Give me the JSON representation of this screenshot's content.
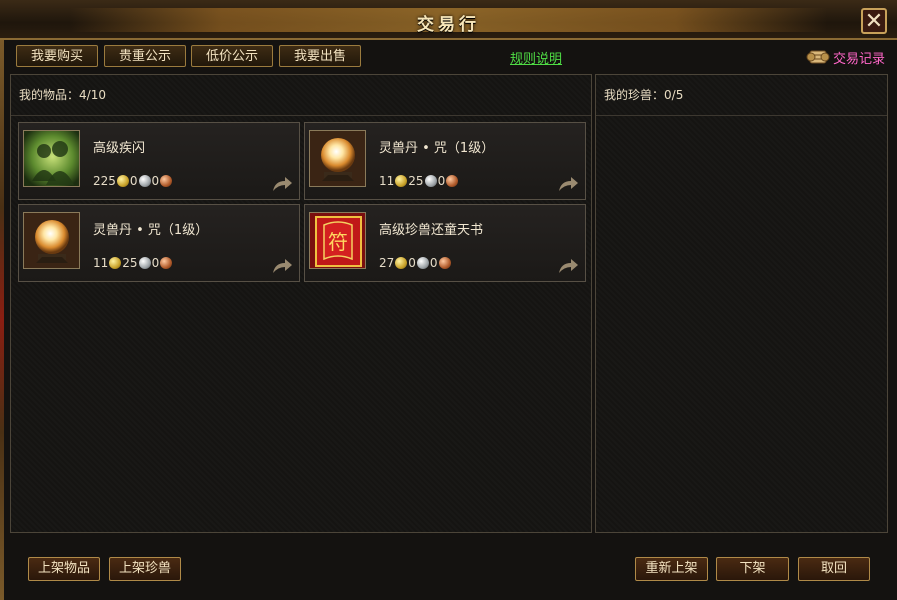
{
  "window": {
    "title": "交易行",
    "close_glyph": "✕"
  },
  "tabs": [
    {
      "label": "我要购买"
    },
    {
      "label": "贵重公示"
    },
    {
      "label": "低价公示"
    },
    {
      "label": "我要出售"
    }
  ],
  "rules_link": "规则说明",
  "trade_record": {
    "label": "交易记录",
    "icon": "scroll-icon"
  },
  "items_panel": {
    "header_label": "我的物品：",
    "count": "4/10",
    "items": [
      {
        "name": "高级疾闪",
        "gold": "225",
        "silver": "0",
        "copper": "0",
        "icon": "speed-skill-icon"
      },
      {
        "name": "灵兽丹 • 咒（1级）",
        "gold": "11",
        "silver": "25",
        "copper": "0",
        "icon": "crystal-orb-icon"
      },
      {
        "name": "灵兽丹 • 咒（1级）",
        "gold": "11",
        "silver": "25",
        "copper": "0",
        "icon": "crystal-orb-icon"
      },
      {
        "name": "高级珍兽还童天书",
        "gold": "27",
        "silver": "0",
        "copper": "0",
        "icon": "red-scroll-book-icon"
      }
    ]
  },
  "pets_panel": {
    "header_label": "我的珍兽：",
    "count": "0/5"
  },
  "bottom_buttons": {
    "list_item": "上架物品",
    "list_pet": "上架珍兽",
    "relist": "重新上架",
    "delist": "下架",
    "cancel": "取回"
  },
  "colors": {
    "rules_link": "#4fdc45",
    "trade_record": "#ff66c8",
    "frame_gold": "#b08a48"
  }
}
